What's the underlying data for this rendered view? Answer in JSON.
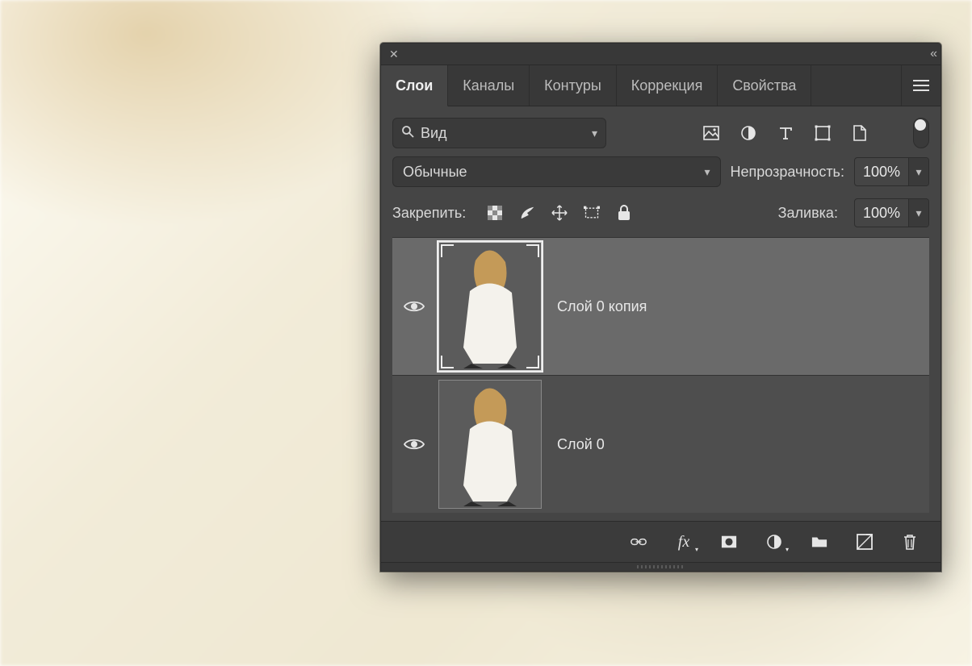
{
  "tabs": {
    "layers": "Слои",
    "channels": "Каналы",
    "paths": "Контуры",
    "adjustments": "Коррекция",
    "properties": "Свойства"
  },
  "filter": {
    "label": "Вид"
  },
  "blend": {
    "mode": "Обычные",
    "opacity_label": "Непрозрачность:",
    "opacity_value": "100%"
  },
  "lock": {
    "label": "Закрепить:"
  },
  "fill": {
    "label": "Заливка:",
    "value": "100%"
  },
  "layers": [
    {
      "name": "Слой 0 копия",
      "selected": true
    },
    {
      "name": "Слой 0",
      "selected": false
    }
  ]
}
